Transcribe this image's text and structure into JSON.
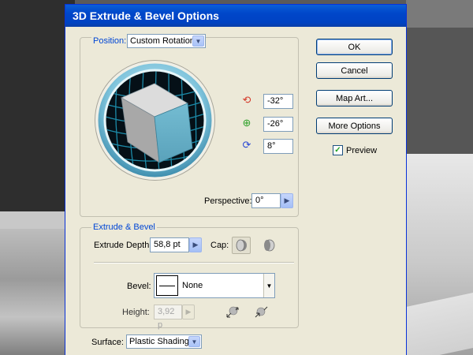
{
  "dialog": {
    "title": "3D Extrude & Bevel Options"
  },
  "position": {
    "legend": "Position:",
    "preset": "Custom Rotation",
    "rotation_x": "-32°",
    "rotation_y": "-26°",
    "rotation_z": "8°",
    "perspective_label": "Perspective:",
    "perspective_value": "0°"
  },
  "buttons": {
    "ok": "OK",
    "cancel": "Cancel",
    "map_art": "Map Art...",
    "more_options": "More Options"
  },
  "preview": {
    "label": "Preview",
    "checked": true
  },
  "extrude": {
    "legend": "Extrude & Bevel",
    "depth_label": "Extrude Depth:",
    "depth_value": "58,8 pt",
    "cap_label": "Cap:",
    "bevel_label": "Bevel:",
    "bevel_value": "None",
    "height_label": "Height:",
    "height_value": "3,92 p"
  },
  "surface": {
    "label": "Surface:",
    "value": "Plastic Shading"
  },
  "colors": {
    "titlebar": "#0046c9",
    "dialog_bg": "#ece9d8",
    "legend_text": "#0046d5",
    "cube_front": "#6ab0c8",
    "cube_top": "#dcdcdc",
    "cube_side": "#a8a8a8"
  }
}
